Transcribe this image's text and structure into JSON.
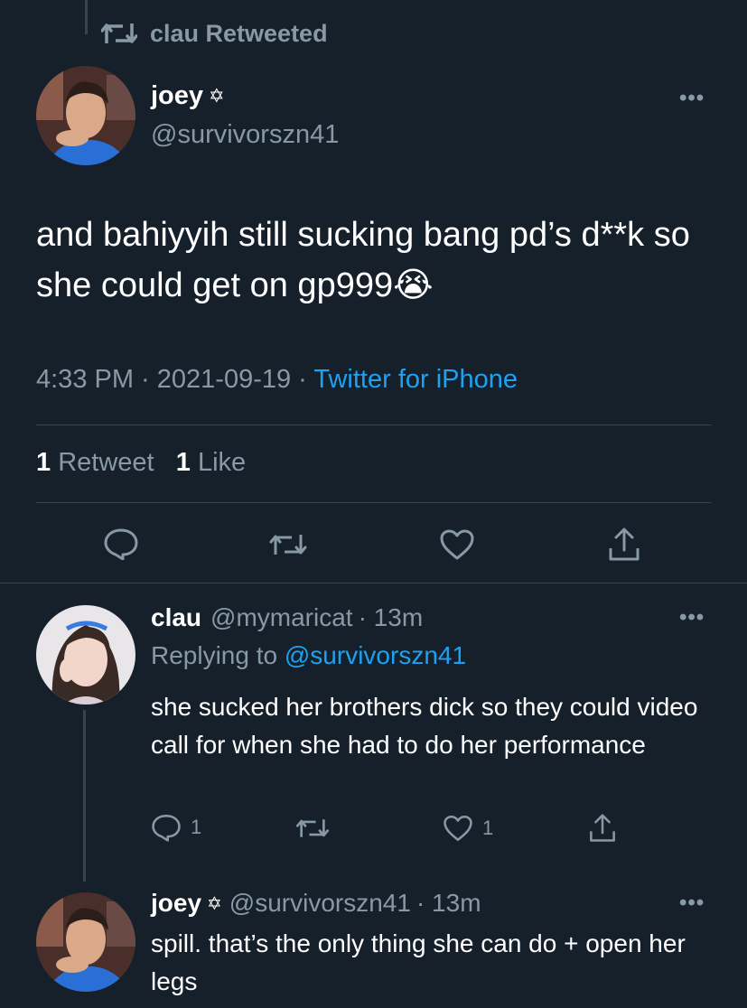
{
  "retweet_header": {
    "label": "clau Retweeted"
  },
  "main_tweet": {
    "display_name": "joey",
    "badge": "✡",
    "handle": "@survivorszn41",
    "text": "and bahiyyih still sucking bang pd’s d**k so she could get on gp999😭",
    "time": "4:33 PM",
    "date": "2021-09-19",
    "separator": " · ",
    "source": "Twitter for iPhone",
    "retweet_count": "1",
    "retweet_label": "Retweet",
    "like_count": "1",
    "like_label": "Like"
  },
  "reply_1": {
    "display_name": "clau",
    "handle": "@mymaricat",
    "time": "· 13m",
    "replying_label": "Replying to ",
    "replying_to": "@survivorszn41",
    "text": "she sucked her brothers dick so they could video call for when she had to do her performance",
    "reply_count": "1",
    "like_count": "1"
  },
  "reply_2": {
    "display_name": "joey",
    "badge": "✡",
    "handle": "@survivorszn41",
    "time": "· 13m",
    "text": "spill. that’s the only thing she can do + open her legs"
  },
  "more_label": "•••",
  "colors": {
    "background": "#15202b",
    "muted": "#8899a6",
    "accent": "#1da1f2",
    "divider": "#38444d"
  },
  "icons": [
    "retweet-icon",
    "reply-icon",
    "like-icon",
    "share-icon",
    "more-icon"
  ]
}
